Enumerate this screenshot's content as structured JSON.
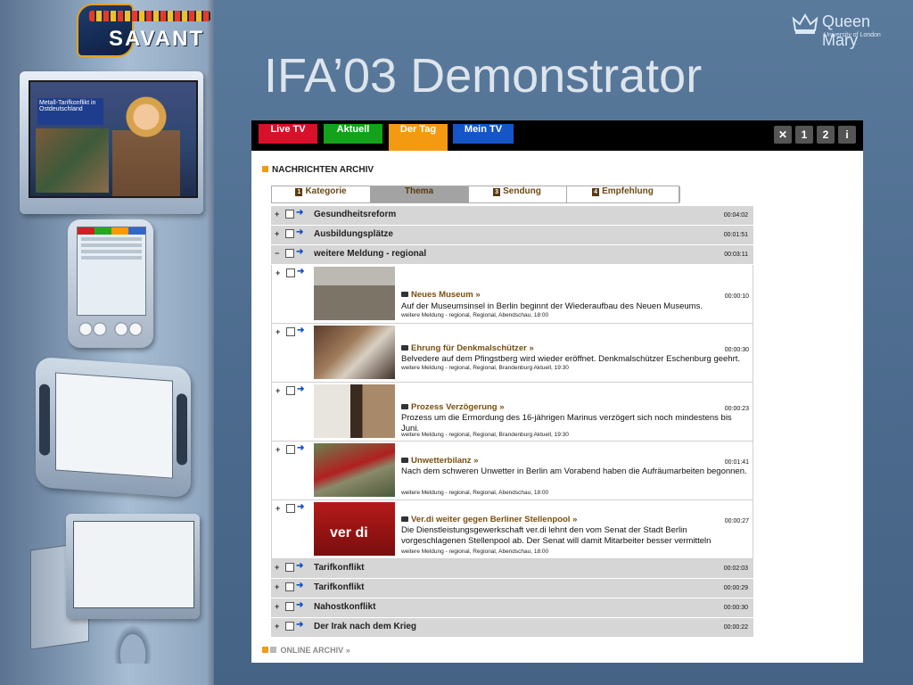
{
  "slide": {
    "title": "IFA’03 Demonstrator",
    "logo_text": "SAVANT",
    "brand_name": "Queen Mary",
    "brand_sub": "University of London"
  },
  "previews": {
    "tv_headline": "Metall-Tarifkonflikt in Ostdeutschland"
  },
  "topbar": {
    "tabs": [
      {
        "label": "Live TV",
        "color": "#d8102a"
      },
      {
        "label": "Aktuell",
        "color": "#13a31b"
      },
      {
        "label": "Der Tag",
        "color": "#f49a12",
        "selected": true
      },
      {
        "label": "Mein TV",
        "color": "#1456c8"
      }
    ],
    "icon_buttons": [
      {
        "icon": "tools-icon",
        "label": "✕"
      },
      {
        "icon": "number-1-icon",
        "label": "1"
      },
      {
        "icon": "number-2-icon",
        "label": "2"
      },
      {
        "icon": "info-icon",
        "label": "i"
      }
    ]
  },
  "section": {
    "title": "NACHRICHTEN ARCHIV"
  },
  "subtabs": [
    {
      "num": "1",
      "label": "Kategorie"
    },
    {
      "num": "",
      "label": "Thema",
      "selected": true
    },
    {
      "num": "3",
      "label": "Sendung"
    },
    {
      "num": "4",
      "label": "Empfehlung"
    }
  ],
  "topics_top": [
    {
      "expander": "+",
      "title": "Gesundheitsreform",
      "time": "00:04:02"
    },
    {
      "expander": "+",
      "title": "Ausbildungsplätze",
      "time": "00:01:51"
    },
    {
      "expander": "−",
      "title": "weitere Meldung - regional",
      "time": "00:03:11"
    }
  ],
  "items": [
    {
      "title": "Neues Museum",
      "time": "00:00:10",
      "desc": "Auf der Museumsinsel in Berlin beginnt der Wiederaufbau des Neuen Museums.",
      "meta": "weitere Meldung - regional, Regional, Abendschau, 18:00"
    },
    {
      "title": "Ehrung für Denkmalschützer",
      "time": "00:00:30",
      "desc": "Belvedere auf dem Pfingstberg wird wieder eröffnet. Denkmalschützer Eschenburg geehrt.",
      "meta": "weitere Meldung - regional, Regional, Brandenburg Aktuell, 19:30"
    },
    {
      "title": "Prozess Verzögerung",
      "time": "00:00:23",
      "desc": "Prozess um die Ermordung des 16-jährigen Marinus verzögert sich noch mindestens bis Juni.",
      "meta": "weitere Meldung - regional, Regional, Brandenburg Aktuell, 19:30"
    },
    {
      "title": "Unwetterbilanz",
      "time": "00:01:41",
      "desc": "Nach dem schweren Unwetter in Berlin am Vorabend haben die Aufräumarbeiten begonnen.",
      "meta": "weitere Meldung - regional, Regional, Abendschau, 18:00"
    },
    {
      "title": "Ver.di weiter gegen Berliner Stellenpool",
      "time": "00:00:27",
      "desc": "Die Dienstleistungsgewerkschaft ver.di lehnt den vom Senat der Stadt Berlin vorgeschlagenen Stellenpool ab. Der Senat will damit Mitarbeiter besser vermitteln",
      "meta": "weitere Meldung - regional, Regional, Abendschau, 18:00",
      "thumb_text": "ver di"
    }
  ],
  "topics_bottom": [
    {
      "expander": "+",
      "title": "Tarifkonflikt",
      "time": "00:02:03"
    },
    {
      "expander": "+",
      "title": "Tarifkonflikt",
      "time": "00:00:29"
    },
    {
      "expander": "+",
      "title": "Nahostkonflikt",
      "time": "00:00:30"
    },
    {
      "expander": "+",
      "title": "Der Irak nach dem Krieg",
      "time": "00:00:22"
    }
  ],
  "footer": {
    "online_label": "ONLINE ARCHIV"
  }
}
